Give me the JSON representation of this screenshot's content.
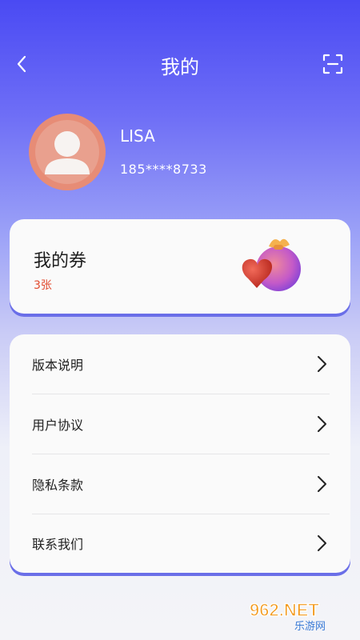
{
  "header": {
    "title": "我的"
  },
  "profile": {
    "name": "LISA",
    "phone": "185****8733"
  },
  "coupon": {
    "title": "我的券",
    "count": "3张"
  },
  "menu": {
    "items": [
      {
        "label": "版本说明"
      },
      {
        "label": "用户协议"
      },
      {
        "label": "隐私条款"
      },
      {
        "label": "联系我们"
      }
    ]
  },
  "watermark": {
    "brand": "962.NET",
    "sub": "乐游网"
  },
  "colors": {
    "accent": "#4a4af3",
    "coupon_count": "#e14a2e",
    "avatar_bg": "#e78c76"
  },
  "icons": {
    "back": "chevron-left-icon",
    "scan": "scan-icon",
    "menu_arrow": "chevron-right-icon"
  }
}
